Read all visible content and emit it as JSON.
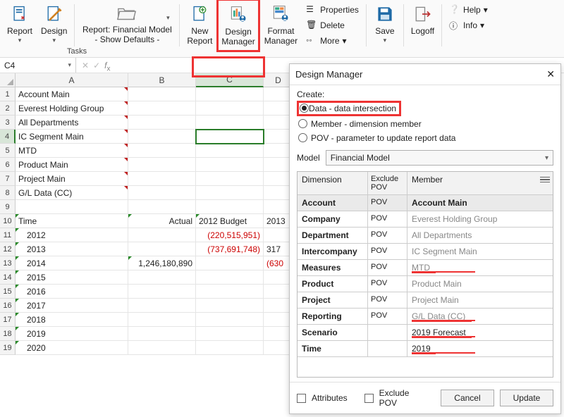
{
  "ribbon": {
    "report": "Report",
    "design": "Design",
    "report_dropdown_l1": "Report: Financial Model",
    "report_dropdown_l2": "- Show Defaults -",
    "new_report": "New\nReport",
    "design_manager": "Design\nManager",
    "format_manager": "Format\nManager",
    "properties": "Properties",
    "delete": "Delete",
    "more": "More",
    "save": "Save",
    "logoff": "Logoff",
    "help": "Help",
    "info": "Info",
    "tasks_label": "Tasks"
  },
  "formula_bar": {
    "cell_ref": "C4"
  },
  "columns": [
    "A",
    "B",
    "C",
    "D"
  ],
  "rows": [
    {
      "n": 1,
      "A": "Account Main"
    },
    {
      "n": 2,
      "A": "Everest Holding Group"
    },
    {
      "n": 3,
      "A": "All Departments"
    },
    {
      "n": 4,
      "A": "IC Segment Main"
    },
    {
      "n": 5,
      "A": "MTD"
    },
    {
      "n": 6,
      "A": "Product Main"
    },
    {
      "n": 7,
      "A": "Project Main"
    },
    {
      "n": 8,
      "A": "G/L Data (CC)"
    },
    {
      "n": 9
    },
    {
      "n": 10,
      "A": "Time",
      "B": "Actual",
      "C": "2012 Budget",
      "D": "2013"
    },
    {
      "n": 11,
      "A": "  2012",
      "C": "(220,515,951)",
      "C_red": true
    },
    {
      "n": 12,
      "A": "  2013",
      "C": "(737,691,748)",
      "C_red": true,
      "D": "317"
    },
    {
      "n": 13,
      "A": "  2014",
      "B": "1,246,180,890",
      "D": "(630",
      "D_red": true
    },
    {
      "n": 14,
      "A": "  2015"
    },
    {
      "n": 15,
      "A": "  2016"
    },
    {
      "n": 16,
      "A": "  2017"
    },
    {
      "n": 17,
      "A": "  2018"
    },
    {
      "n": 18,
      "A": "  2019"
    },
    {
      "n": 19,
      "A": "  2020"
    }
  ],
  "panel": {
    "title": "Design Manager",
    "create_label": "Create:",
    "opt_data": "Data - data intersection",
    "opt_member": "Member - dimension member",
    "opt_pov": "POV - parameter to update report data",
    "model_label": "Model",
    "model_value": "Financial Model",
    "head_dim": "Dimension",
    "head_excl": "Exclude\nPOV",
    "head_member": "Member",
    "rows": [
      {
        "dim": "Account",
        "pov": "POV",
        "member": "Account Main",
        "sel": true
      },
      {
        "dim": "Company",
        "pov": "POV",
        "member": "Everest Holding Group"
      },
      {
        "dim": "Department",
        "pov": "POV",
        "member": "All Departments"
      },
      {
        "dim": "Intercompany",
        "pov": "POV",
        "member": "IC Segment Main"
      },
      {
        "dim": "Measures",
        "pov": "POV",
        "member": "MTD",
        "ul": true
      },
      {
        "dim": "Product",
        "pov": "POV",
        "member": "Product Main"
      },
      {
        "dim": "Project",
        "pov": "POV",
        "member": "Project Main"
      },
      {
        "dim": "Reporting",
        "pov": "POV",
        "member": "G/L Data (CC)",
        "ul": true
      },
      {
        "dim": "Scenario",
        "pov": "",
        "member": "2019 Forecast",
        "bold": true,
        "ul": true
      },
      {
        "dim": "Time",
        "pov": "",
        "member": "2019",
        "bold": true,
        "ul": true
      }
    ],
    "attributes": "Attributes",
    "exclude_pov": "Exclude POV",
    "cancel": "Cancel",
    "update": "Update"
  }
}
